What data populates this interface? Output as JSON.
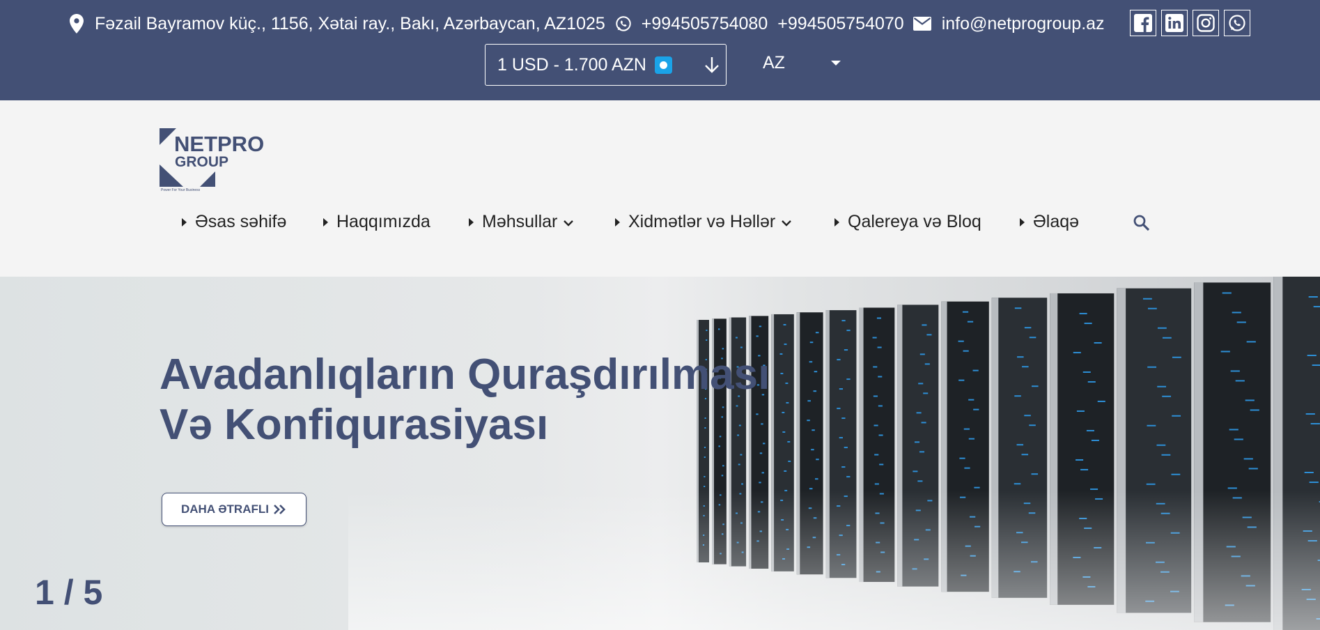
{
  "topbar": {
    "address": "Fəzail Bayramov küç., 1156, Xətai ray., Bakı, Azərbaycan, AZ1025",
    "phone1": "+994505754080",
    "phone2": "+994505754070",
    "email": "info@netprogroup.az",
    "socials": [
      "facebook-icon",
      "linkedin-icon",
      "instagram-icon",
      "whatsapp-icon"
    ],
    "currency_label": "1 USD - 1.700 AZN",
    "language": "AZ",
    "background_color": "#435075"
  },
  "logo": {
    "line1": "NETPRO",
    "line2": "GROUP",
    "tagline": "Power For Your Business"
  },
  "nav": {
    "items": [
      {
        "label": "Əsas səhifə",
        "has_dropdown": false
      },
      {
        "label": "Haqqımızda",
        "has_dropdown": false
      },
      {
        "label": "Məhsullar",
        "has_dropdown": true
      },
      {
        "label": "Xidmətlər və Həllər",
        "has_dropdown": true
      },
      {
        "label": "Qalereya və Bloq",
        "has_dropdown": false
      },
      {
        "label": "Əlaqə",
        "has_dropdown": false
      }
    ],
    "search_icon": "search-icon"
  },
  "hero": {
    "title_line1": "Avadanlıqların Quraşdırılması",
    "title_line2": "Və Konfiqurasiyası",
    "button_label": "DAHA ƏTRAFLI",
    "slide_counter": "1 / 5",
    "accent_color": "#435075"
  }
}
